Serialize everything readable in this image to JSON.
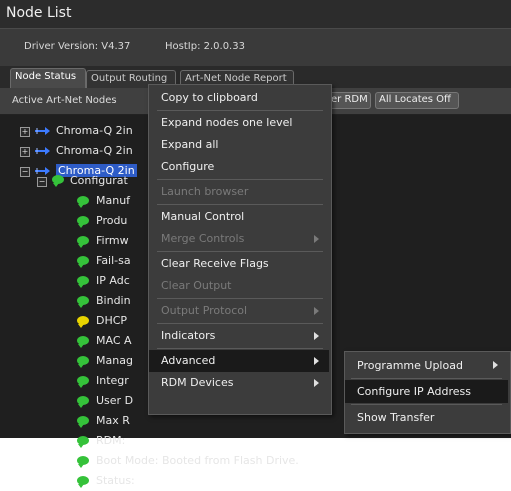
{
  "window": {
    "title": "Node List"
  },
  "info": {
    "driver_version": "Driver Version: V4.37",
    "host_ip": "HostIp: 2.0.0.33"
  },
  "tabs": [
    {
      "label": "Node Status"
    },
    {
      "label": "Output Routing"
    },
    {
      "label": "Art-Net Node Report"
    }
  ],
  "actionbar": {
    "label": "Active Art-Net Nodes",
    "buttons": [
      {
        "label": "er RDM"
      },
      {
        "label": "All Locates Off"
      }
    ]
  },
  "tree": {
    "nodes": [
      {
        "label": "Chroma-Q 2in",
        "selected": false
      },
      {
        "label": "Chroma-Q 2in",
        "selected": false
      },
      {
        "label": "Chroma-Q 2in",
        "selected": true
      }
    ],
    "config_label": "Configurat",
    "children": [
      {
        "label": "Manuf",
        "status": "ok"
      },
      {
        "label": "Produ",
        "status": "ok"
      },
      {
        "label": "Firmw",
        "status": "ok"
      },
      {
        "label": "Fail-sa",
        "status": "ok"
      },
      {
        "label": "IP Adc",
        "status": "ok"
      },
      {
        "label": "Bindin",
        "status": "ok"
      },
      {
        "label": "DHCP",
        "status": "dhcp"
      },
      {
        "label": "MAC A",
        "status": "ok"
      },
      {
        "label": "Manag",
        "status": "ok"
      },
      {
        "label": "Integr",
        "status": "ok"
      },
      {
        "label": "User D",
        "status": "ok"
      },
      {
        "label": "Max R",
        "status": "ok"
      },
      {
        "label": "RDM:",
        "status": "ok"
      },
      {
        "label": "Boot Mode: Booted from Flash Drive.",
        "status": "ok"
      },
      {
        "label": "Status:",
        "status": "ok"
      }
    ]
  },
  "context_menu": {
    "items": [
      {
        "label": "Copy to clipboard",
        "enabled": true,
        "submenu": false
      },
      {
        "label": "Expand nodes one level",
        "enabled": true,
        "submenu": false
      },
      {
        "label": "Expand all",
        "enabled": true,
        "submenu": false
      },
      {
        "label": "Configure",
        "enabled": true,
        "submenu": false
      },
      {
        "label": "Launch browser",
        "enabled": false,
        "submenu": false
      },
      {
        "label": "Manual Control",
        "enabled": true,
        "submenu": false
      },
      {
        "label": "Merge Controls",
        "enabled": false,
        "submenu": true
      },
      {
        "label": "Clear Receive Flags",
        "enabled": true,
        "submenu": false
      },
      {
        "label": "Clear Output",
        "enabled": false,
        "submenu": false
      },
      {
        "label": "Output Protocol",
        "enabled": false,
        "submenu": true
      },
      {
        "label": "Indicators",
        "enabled": true,
        "submenu": true
      },
      {
        "label": "Advanced",
        "enabled": true,
        "submenu": true,
        "active": true
      },
      {
        "label": "RDM Devices",
        "enabled": true,
        "submenu": true
      }
    ]
  },
  "submenu": {
    "items": [
      {
        "label": "Programme Upload",
        "submenu": true
      },
      {
        "label": "Configure IP Address",
        "submenu": false,
        "active": true
      },
      {
        "label": "Show Transfer",
        "submenu": false
      }
    ]
  },
  "colors": {
    "background": "#1c1c1c",
    "menu": "#3c3c3c",
    "selection": "#2e5cc7",
    "status_ok": "#35c23a",
    "status_warn": "#e8d400"
  }
}
